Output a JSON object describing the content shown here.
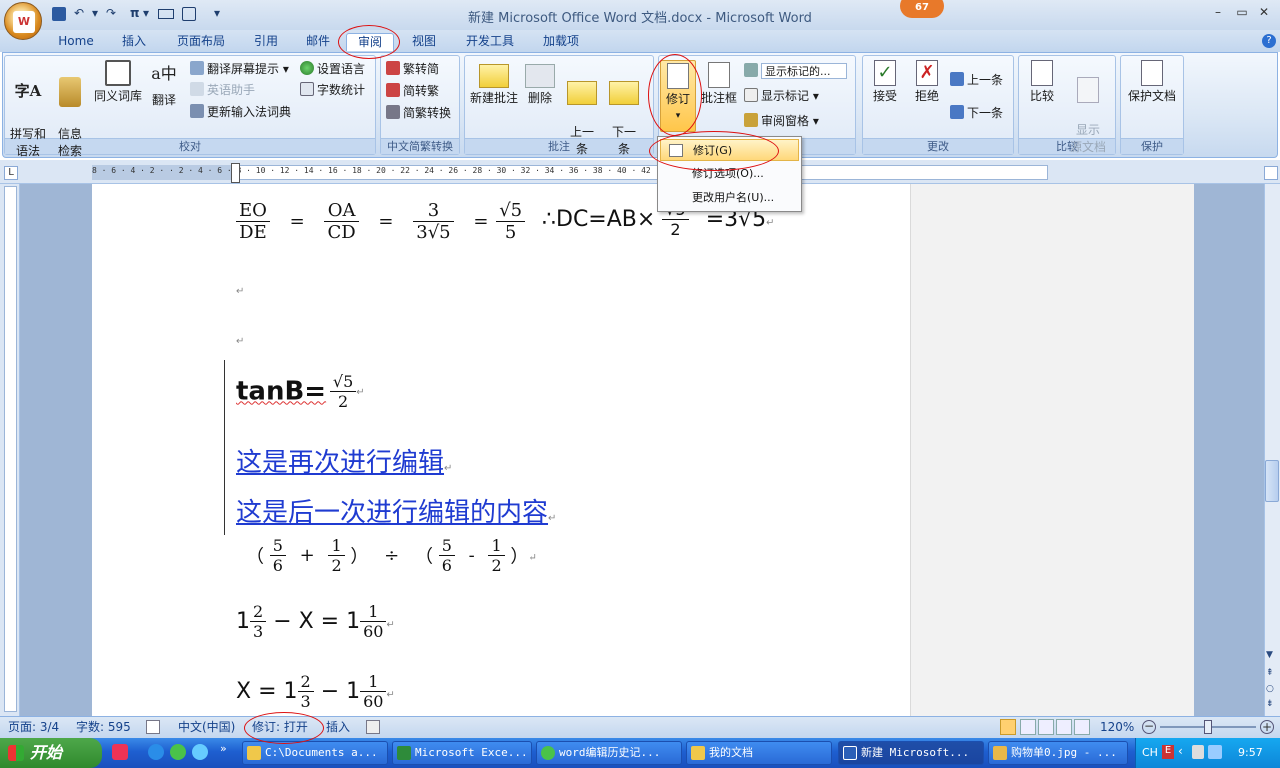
{
  "window": {
    "title": "新建 Microsoft Office Word 文档.docx - Microsoft Word",
    "office_button_label": "Office",
    "notification_count": "67",
    "minimize_icon": "minimize-icon",
    "restore_icon": "restore-icon",
    "close_icon": "close-icon"
  },
  "qat": {
    "save": "save-icon",
    "undo": "↶",
    "redo": "↷",
    "pi": "π",
    "more": "▾"
  },
  "tabs": [
    "Home",
    "插入",
    "页面布局",
    "引用",
    "邮件",
    "审阅",
    "视图",
    "开发工具",
    "加载项"
  ],
  "active_tab": "审阅",
  "ribbon": {
    "proofing": {
      "label": "校对",
      "spelling": "拼写和\n语法",
      "research": "信息\n检索",
      "thesaurus": "同义词库",
      "translate": "翻译",
      "translate_tip": "翻译屏幕提示",
      "english_assistant": "英语助手",
      "update_ime": "更新输入法词典",
      "set_language": "设置语言",
      "word_count": "字数统计"
    },
    "chinese_conversion": {
      "label": "中文简繁转换",
      "to_traditional": "繁转简",
      "to_simplified": "简转繁",
      "convert": "简繁转换"
    },
    "comments": {
      "label": "批注",
      "new_comment": "新建批注",
      "delete": "删除",
      "previous": "上一\n条",
      "next": "下一\n条"
    },
    "tracking": {
      "label": "修订",
      "track_changes": "修订",
      "balloons": "批注框",
      "display_for_review": "显示标记的...",
      "show_markup": "显示标记",
      "reviewing_pane": "审阅窗格"
    },
    "changes": {
      "label": "更改",
      "accept": "接受",
      "reject": "拒绝",
      "previous": "上一条",
      "next": "下一条"
    },
    "compare": {
      "label": "比较",
      "compare": "比较",
      "show_source": "显示\n源文档"
    },
    "protect": {
      "label": "保护",
      "protect_document": "保护文档"
    }
  },
  "dropdown": {
    "items": [
      "修订(G)",
      "修订选项(O)...",
      "更改用户名(U)..."
    ]
  },
  "ruler": {
    "ticks": "8 · 6 · 4 · 2 ·  · 2 · 4 · 6 · 8 · 10 · 12 · 14 · 16 · 18 · 20 · 22 · 24 · 26 · 28 · 30 · 32 · 34 · 36 · 38 · 40 · 42 · 44 · 46 · 48",
    "tab_selector": "L"
  },
  "document": {
    "eq1": {
      "f1n": "EO",
      "f1d": "DE",
      "eq": "=",
      "f2n": "OA",
      "f2d": "CD",
      "f3n": "3",
      "f3d": "3√5",
      "f4n": "√5",
      "f4d": "5",
      "therefore": "∴DC=AB×",
      "f5n": "√5",
      "f5d": "2",
      "result": "=3√5",
      "mark": "↵"
    },
    "empty_para_mark": "↵",
    "tanb": {
      "label": "tanB=",
      "n": "√5",
      "d": "2",
      "mark": "↵"
    },
    "rev1": "这是再次进行编辑",
    "rev2": "这是后一次进行编辑的内容",
    "expr": {
      "open": "（",
      "a_n": "5",
      "a_d": "6",
      "plus": "+",
      "b_n": "1",
      "b_d": "2",
      "close": "）",
      "div": "÷",
      "open2": "（",
      "c_n": "5",
      "c_d": "6",
      "minus": "-",
      "d_n": "1",
      "d_d": "2",
      "close2": "）",
      "mark": "↵"
    },
    "eq2": {
      "w1": "1",
      "n1": "2",
      "d1": "3",
      "mid": "− X = 1",
      "n2": "1",
      "d2": "60",
      "mark": "↵"
    },
    "eq3": {
      "lhs": "X = 1",
      "n1": "2",
      "d1": "3",
      "mid": "− 1",
      "n2": "1",
      "d2": "60",
      "mark": "↵"
    }
  },
  "status": {
    "page": "页面: 3/4",
    "words": "字数: 595",
    "language": "中文(中国)",
    "track": "修订: 打开",
    "insert": "插入",
    "zoom": "120%"
  },
  "taskbar": {
    "start": "开始",
    "tasks": [
      "C:\\Documents a...",
      "Microsoft Exce...",
      "word编辑历史记...",
      "我的文档",
      "新建 Microsoft...",
      "购物单0.jpg - ..."
    ],
    "ime": "CH",
    "clock": "9:57"
  }
}
